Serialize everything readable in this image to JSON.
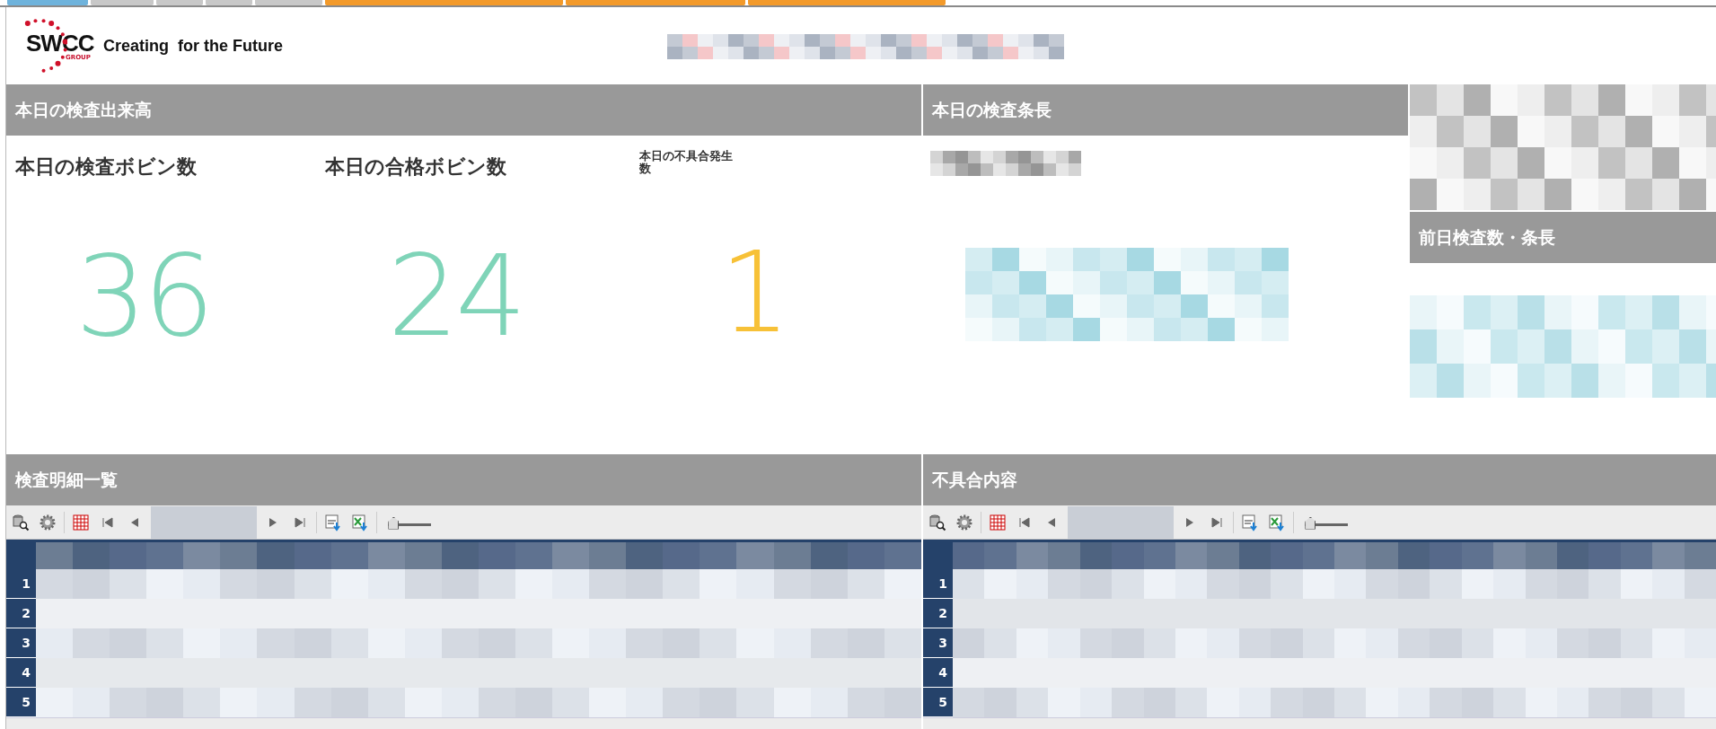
{
  "top_tabs": [
    {
      "color": "#6fb3dc"
    },
    {
      "color": "#c8c8c8"
    },
    {
      "color": "#c8c8c8"
    },
    {
      "color": "#c8c8c8"
    },
    {
      "color": "#c8c8c8"
    },
    {
      "color": "#f39a2a"
    },
    {
      "color": "#f39a2a"
    },
    {
      "color": "#f39a2a"
    }
  ],
  "header": {
    "logo": "SWCC",
    "logo_sub": "GROUP",
    "tagline": "Creating  for the Future"
  },
  "output_panel": {
    "title": "本日の検査出来高",
    "metrics": [
      {
        "label": "本日の検査ボビン数",
        "kind": "large",
        "value": "36",
        "color": "#7fd4b8"
      },
      {
        "label": "本日の合格ボビン数",
        "kind": "large",
        "value": "24",
        "color": "#7fd4b8"
      },
      {
        "label": "本日の不具合発生数",
        "kind": "small",
        "value": "1",
        "color": "#f7c137"
      }
    ]
  },
  "length_panel": {
    "title": "本日の検査条長"
  },
  "previous_panel": {
    "title": "前日検査数・条長"
  },
  "grids": [
    {
      "title": "検査明細一覧",
      "rows": [
        "1",
        "2",
        "3",
        "4",
        "5"
      ],
      "zoom": {
        "level": 0.05
      }
    },
    {
      "title": "不具合内容",
      "rows": [
        "1",
        "2",
        "3",
        "4",
        "5"
      ],
      "zoom": {
        "level": 0.05
      }
    }
  ]
}
